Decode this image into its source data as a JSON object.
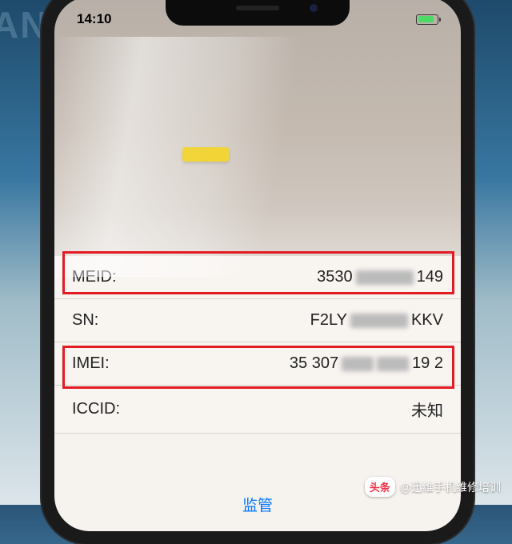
{
  "background": {
    "mat_text": "ANS"
  },
  "status_bar": {
    "time": "14:10"
  },
  "rows": {
    "meid": {
      "label": "MEID:",
      "value_prefix": "3530",
      "value_suffix": "149"
    },
    "sn": {
      "label": "SN:",
      "value_prefix": "F2LY",
      "value_suffix": "KKV"
    },
    "imei": {
      "label": "IMEI:",
      "value_prefix": "35 307",
      "value_suffix": "19 2"
    },
    "iccid": {
      "label": "ICCID:",
      "value": "未知"
    }
  },
  "bottom_link": "监管",
  "watermark": {
    "badge": "头条",
    "text": "@迅维手机维修培训"
  }
}
